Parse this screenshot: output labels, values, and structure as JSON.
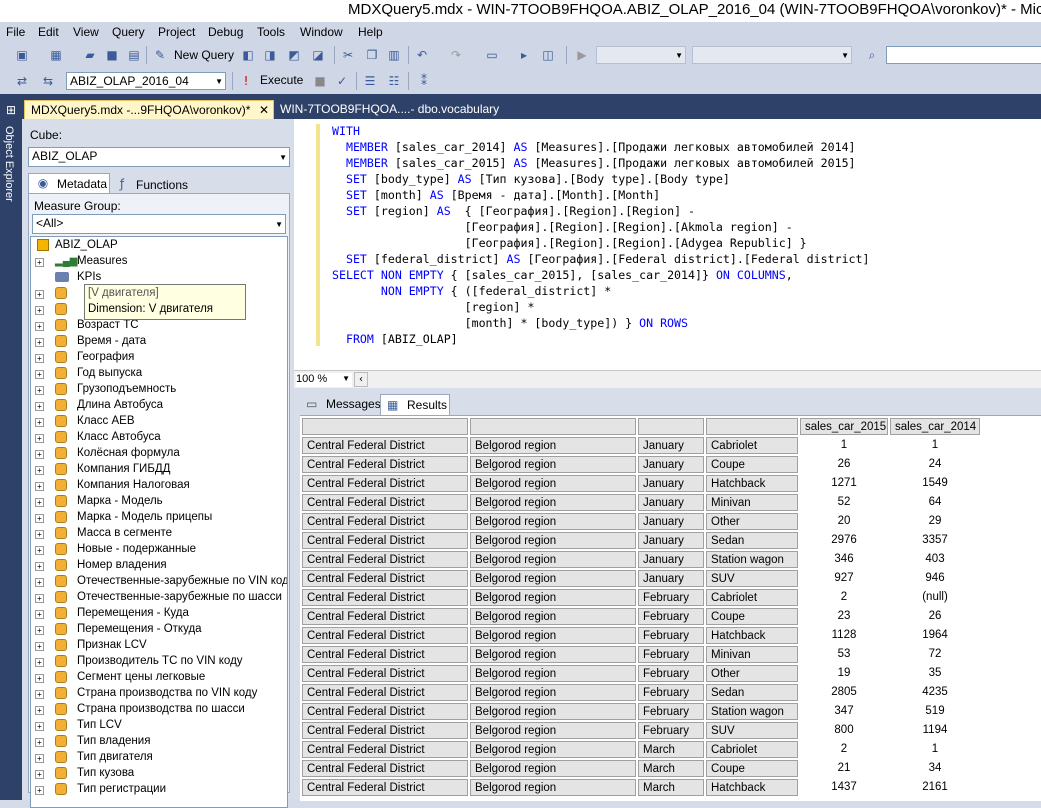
{
  "window": {
    "title": "MDXQuery5.mdx - WIN-7TOOB9FHQOA.ABIZ_OLAP_2016_04 (WIN-7TOOB9FHQOA\\voronkov)* - Microsoft"
  },
  "menu": [
    "File",
    "Edit",
    "View",
    "Query",
    "Project",
    "Debug",
    "Tools",
    "Window",
    "Help"
  ],
  "toolbar1": {
    "new_query": "New Query"
  },
  "toolbar2": {
    "database": "ABIZ_OLAP_2016_04",
    "execute": "Execute"
  },
  "object_explorer_label": "Object Explorer",
  "tabs": [
    {
      "label": "MDXQuery5.mdx -...9FHQOA\\voronkov)*"
    },
    {
      "label": "WIN-7TOOB9FHQOA....- dbo.vocabulary"
    }
  ],
  "cube": {
    "label": "Cube:",
    "value": "ABIZ_OLAP"
  },
  "metadata_tabs": [
    "Metadata",
    "Functions"
  ],
  "measure_group": {
    "label": "Measure Group:",
    "value": "<All>"
  },
  "tree": {
    "root": "ABIZ_OLAP",
    "measures": "Measures",
    "kpis": "KPIs",
    "tooltip": {
      "title": "[V двигателя]",
      "subtitle": "Dimension: V двигателя"
    },
    "items": [
      "Возраст ТС",
      "Время - дата",
      "География",
      "Год выпуска",
      "Грузоподъемность",
      "Длина Автобуса",
      "Класс АЕВ",
      "Класс Автобуса",
      "Колёсная формула",
      "Компания ГИБДД",
      "Компания Налоговая",
      "Марка - Модель",
      "Марка - Модель прицепы",
      "Масса в сегменте",
      "Новые - подержанные",
      "Номер владения",
      "Отечественные-зарубежные по VIN коду",
      "Отечественные-зарубежные по шасси",
      "Перемещения - Куда",
      "Перемещения - Откуда",
      "Признак LCV",
      "Производитель ТС по VIN коду",
      "Сегмент цены легковые",
      "Страна производства по VIN коду",
      "Страна производства по шасси",
      "Тип LCV",
      "Тип владения",
      "Тип двигателя",
      "Тип кузова",
      "Тип регистрации"
    ]
  },
  "code": [
    "WITH",
    "  MEMBER [sales_car_2014] AS [Measures].[Продажи легковых автомобилей 2014]",
    "  MEMBER [sales_car_2015] AS [Measures].[Продажи легковых автомобилей 2015]",
    "  SET [body_type] AS [Тип кузова].[Body type].[Body type]",
    "  SET [month] AS [Время - дата].[Month].[Month]",
    "  SET [region] AS  { [География].[Region].[Region] -",
    "                   [География].[Region].[Region].[Akmola region] -",
    "                   [География].[Region].[Region].[Adygea Republic] }",
    "  SET [federal_district] AS [География].[Federal district].[Federal district]",
    "SELECT NON EMPTY { [sales_car_2015], [sales_car_2014]} ON COLUMNS,",
    "       NON EMPTY { ([federal_district] *",
    "                   [region] *",
    "                   [month] * [body_type]) } ON ROWS",
    "  FROM [ABIZ_OLAP]"
  ],
  "zoom": "100 %",
  "result_tabs": [
    "Messages",
    "Results"
  ],
  "results": {
    "columns": [
      "",
      "",
      "",
      "",
      "sales_car_2015",
      "sales_car_2014"
    ],
    "rows": [
      [
        "Central Federal District",
        "Belgorod region",
        "January",
        "Cabriolet",
        "1",
        "1"
      ],
      [
        "Central Federal District",
        "Belgorod region",
        "January",
        "Coupe",
        "26",
        "24"
      ],
      [
        "Central Federal District",
        "Belgorod region",
        "January",
        "Hatchback",
        "1271",
        "1549"
      ],
      [
        "Central Federal District",
        "Belgorod region",
        "January",
        "Minivan",
        "52",
        "64"
      ],
      [
        "Central Federal District",
        "Belgorod region",
        "January",
        "Other",
        "20",
        "29"
      ],
      [
        "Central Federal District",
        "Belgorod region",
        "January",
        "Sedan",
        "2976",
        "3357"
      ],
      [
        "Central Federal District",
        "Belgorod region",
        "January",
        "Station wagon",
        "346",
        "403"
      ],
      [
        "Central Federal District",
        "Belgorod region",
        "January",
        "SUV",
        "927",
        "946"
      ],
      [
        "Central Federal District",
        "Belgorod region",
        "February",
        "Cabriolet",
        "2",
        "(null)"
      ],
      [
        "Central Federal District",
        "Belgorod region",
        "February",
        "Coupe",
        "23",
        "26"
      ],
      [
        "Central Federal District",
        "Belgorod region",
        "February",
        "Hatchback",
        "1128",
        "1964"
      ],
      [
        "Central Federal District",
        "Belgorod region",
        "February",
        "Minivan",
        "53",
        "72"
      ],
      [
        "Central Federal District",
        "Belgorod region",
        "February",
        "Other",
        "19",
        "35"
      ],
      [
        "Central Federal District",
        "Belgorod region",
        "February",
        "Sedan",
        "2805",
        "4235"
      ],
      [
        "Central Federal District",
        "Belgorod region",
        "February",
        "Station wagon",
        "347",
        "519"
      ],
      [
        "Central Federal District",
        "Belgorod region",
        "February",
        "SUV",
        "800",
        "1194"
      ],
      [
        "Central Federal District",
        "Belgorod region",
        "March",
        "Cabriolet",
        "2",
        "1"
      ],
      [
        "Central Federal District",
        "Belgorod region",
        "March",
        "Coupe",
        "21",
        "34"
      ],
      [
        "Central Federal District",
        "Belgorod region",
        "March",
        "Hatchback",
        "1437",
        "2161"
      ]
    ]
  }
}
